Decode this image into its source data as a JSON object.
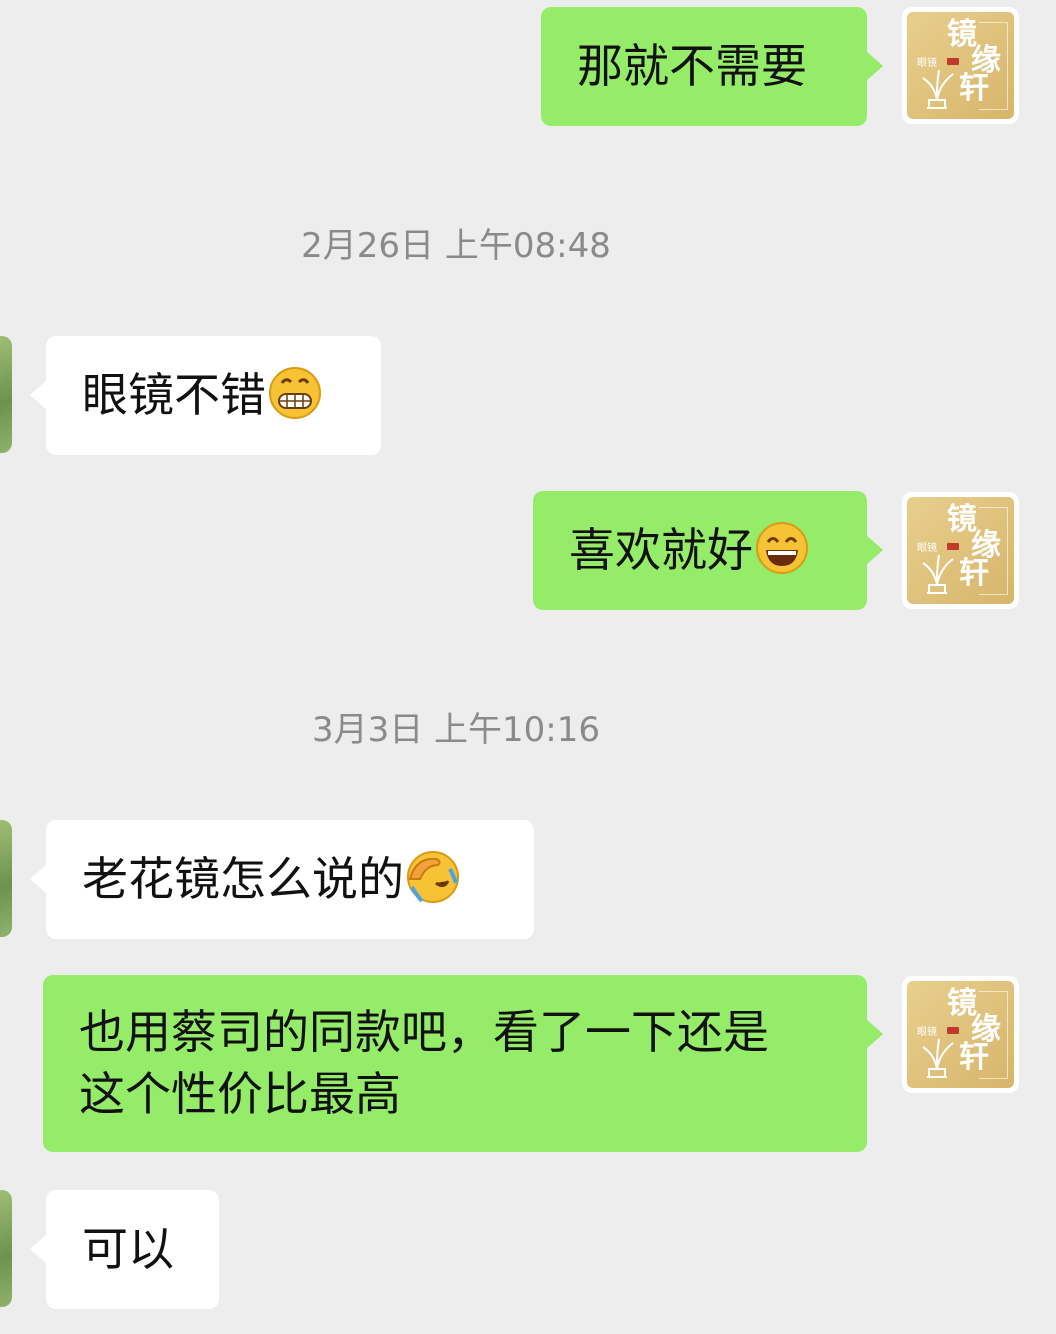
{
  "messages": [
    {
      "side": "out",
      "text": "那就不需要"
    },
    {
      "type": "time",
      "text": "2月26日 上午08:48"
    },
    {
      "side": "in",
      "text": "眼镜不错",
      "emoji": "grinning-teeth-face"
    },
    {
      "side": "out",
      "text": "喜欢就好",
      "emoji": "smiling-face"
    },
    {
      "type": "time",
      "text": "3月3日 上午10:16"
    },
    {
      "side": "in",
      "text": "老花镜怎么说的",
      "emoji": "facepalm-laughing-face"
    },
    {
      "side": "out",
      "line1": "也用蔡司的同款吧，看了一下还是",
      "line2": "这个性价比最高"
    },
    {
      "side": "in",
      "text": "可以"
    }
  ],
  "avatar_self": {
    "c1": "镜",
    "c2": "缘",
    "c3": "轩",
    "small": "眼镜",
    "icon": "glasses-shop-logo"
  },
  "colors": {
    "outgoing_bubble": "#95ec69",
    "incoming_bubble": "#ffffff",
    "background": "#ededed",
    "timestamp": "#8a8a8a"
  }
}
